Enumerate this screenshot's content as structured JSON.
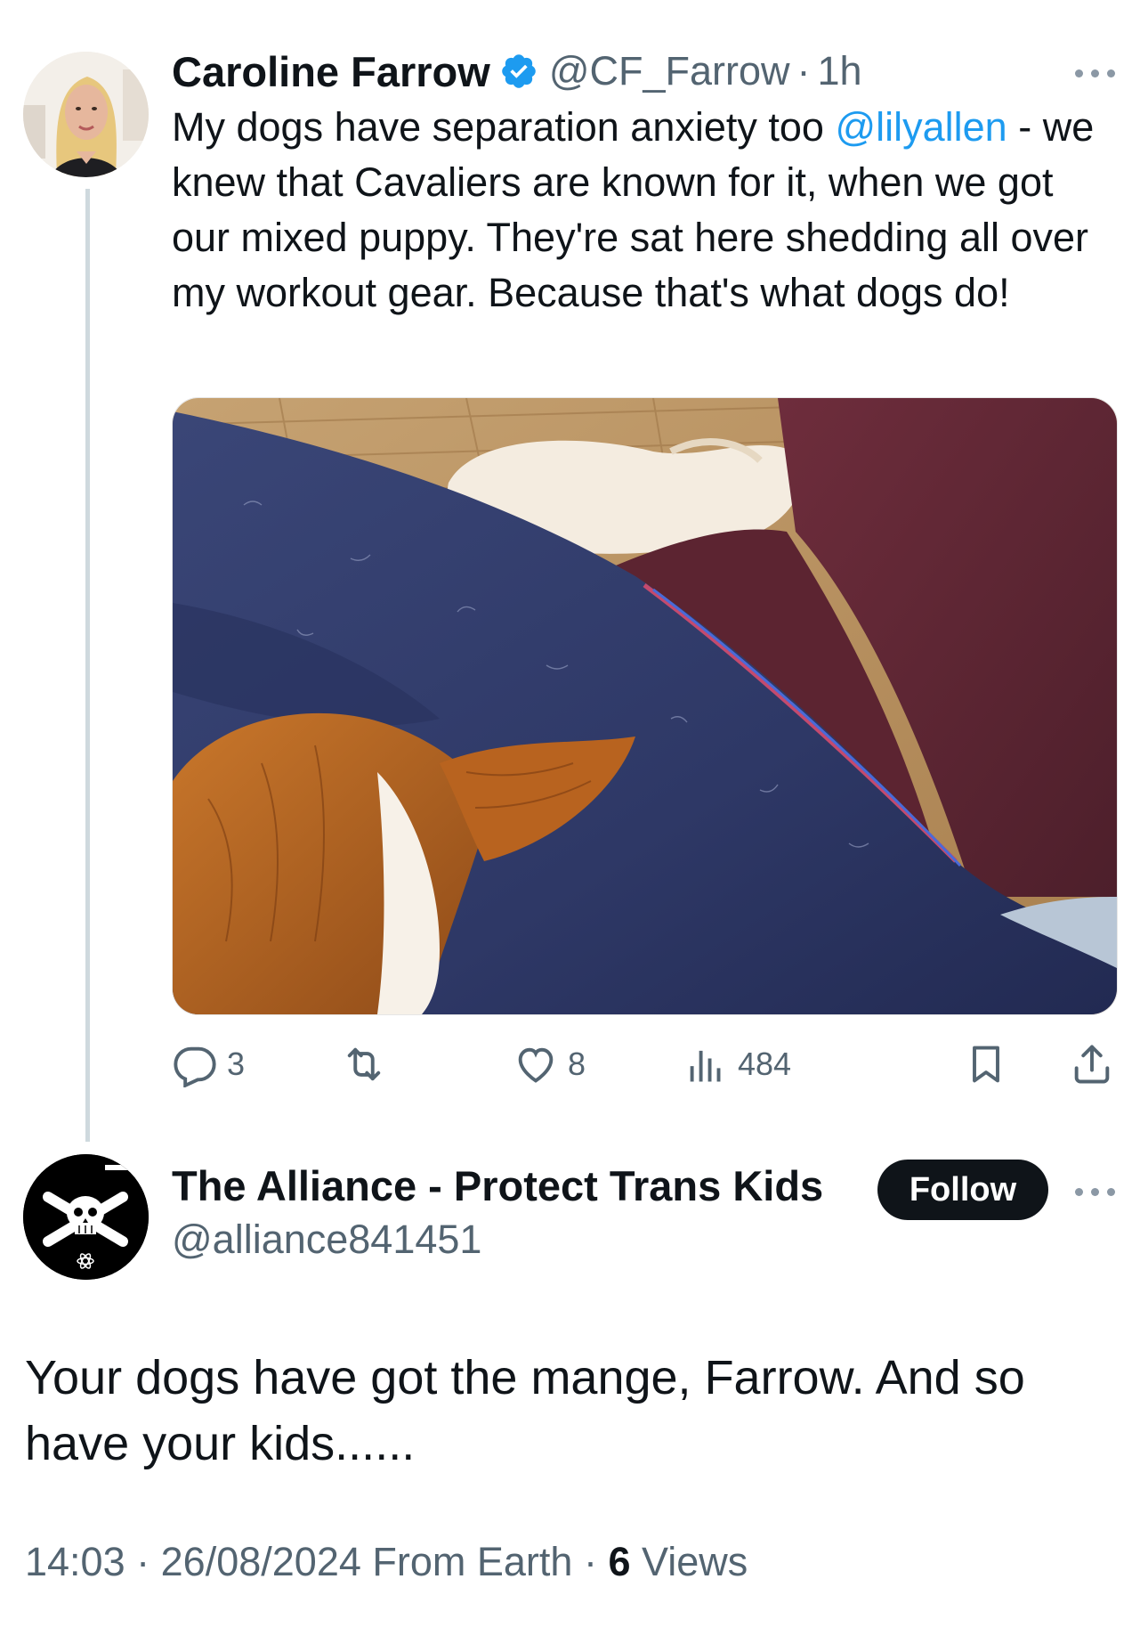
{
  "colors": {
    "text_primary": "#0f1419",
    "text_secondary": "#536471",
    "link": "#1d9bf0",
    "verified": "#1d9bf0",
    "thread_line": "#cfd9de",
    "follow_bg": "#0f1419"
  },
  "tweet": {
    "author_name": "Caroline Farrow",
    "handle": "@CF_Farrow",
    "separator": "·",
    "time": "1h",
    "text_before_mention": "My dogs have separation anxiety too ",
    "mention": "@lilyallen",
    "text_after_mention": " - we knew that Cavaliers are known for it, when we got our mixed puppy. They're sat here shedding all over my workout gear. Because that's what dogs do!",
    "media_icon": "photo-dog-on-leggings",
    "stats": {
      "replies": "3",
      "reposts": "",
      "likes": "8",
      "views": "484"
    }
  },
  "reply": {
    "author_name": "The Alliance - Protect Trans Kids",
    "handle": "@alliance841451",
    "follow_label": "Follow",
    "text": "Your dogs have got the mange, Farrow.  And so have your kids......",
    "time": "14:03",
    "sep1": "·",
    "date": "26/08/2024",
    "source": "From Earth",
    "sep2": "·",
    "views_count": "6",
    "views_label": "Views"
  }
}
